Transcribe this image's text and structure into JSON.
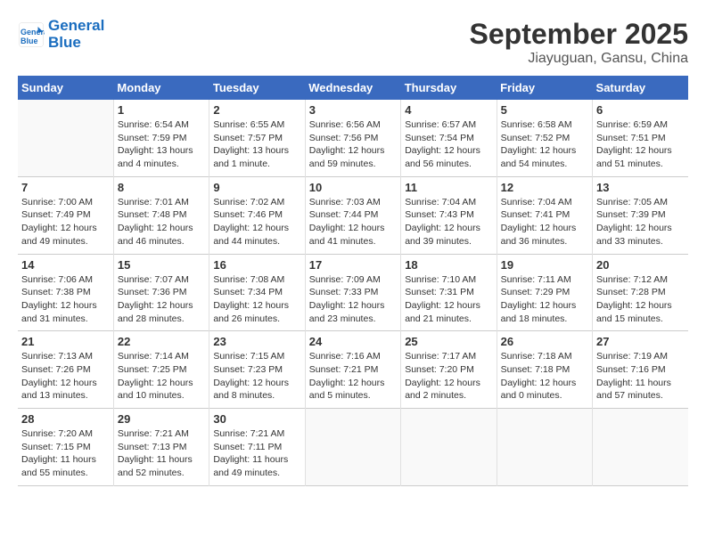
{
  "header": {
    "logo_line1": "General",
    "logo_line2": "Blue",
    "title": "September 2025",
    "subtitle": "Jiayuguan, Gansu, China"
  },
  "days_of_week": [
    "Sunday",
    "Monday",
    "Tuesday",
    "Wednesday",
    "Thursday",
    "Friday",
    "Saturday"
  ],
  "weeks": [
    [
      {
        "day": "",
        "info": ""
      },
      {
        "day": "1",
        "info": "Sunrise: 6:54 AM\nSunset: 7:59 PM\nDaylight: 13 hours\nand 4 minutes."
      },
      {
        "day": "2",
        "info": "Sunrise: 6:55 AM\nSunset: 7:57 PM\nDaylight: 13 hours\nand 1 minute."
      },
      {
        "day": "3",
        "info": "Sunrise: 6:56 AM\nSunset: 7:56 PM\nDaylight: 12 hours\nand 59 minutes."
      },
      {
        "day": "4",
        "info": "Sunrise: 6:57 AM\nSunset: 7:54 PM\nDaylight: 12 hours\nand 56 minutes."
      },
      {
        "day": "5",
        "info": "Sunrise: 6:58 AM\nSunset: 7:52 PM\nDaylight: 12 hours\nand 54 minutes."
      },
      {
        "day": "6",
        "info": "Sunrise: 6:59 AM\nSunset: 7:51 PM\nDaylight: 12 hours\nand 51 minutes."
      }
    ],
    [
      {
        "day": "7",
        "info": "Sunrise: 7:00 AM\nSunset: 7:49 PM\nDaylight: 12 hours\nand 49 minutes."
      },
      {
        "day": "8",
        "info": "Sunrise: 7:01 AM\nSunset: 7:48 PM\nDaylight: 12 hours\nand 46 minutes."
      },
      {
        "day": "9",
        "info": "Sunrise: 7:02 AM\nSunset: 7:46 PM\nDaylight: 12 hours\nand 44 minutes."
      },
      {
        "day": "10",
        "info": "Sunrise: 7:03 AM\nSunset: 7:44 PM\nDaylight: 12 hours\nand 41 minutes."
      },
      {
        "day": "11",
        "info": "Sunrise: 7:04 AM\nSunset: 7:43 PM\nDaylight: 12 hours\nand 39 minutes."
      },
      {
        "day": "12",
        "info": "Sunrise: 7:04 AM\nSunset: 7:41 PM\nDaylight: 12 hours\nand 36 minutes."
      },
      {
        "day": "13",
        "info": "Sunrise: 7:05 AM\nSunset: 7:39 PM\nDaylight: 12 hours\nand 33 minutes."
      }
    ],
    [
      {
        "day": "14",
        "info": "Sunrise: 7:06 AM\nSunset: 7:38 PM\nDaylight: 12 hours\nand 31 minutes."
      },
      {
        "day": "15",
        "info": "Sunrise: 7:07 AM\nSunset: 7:36 PM\nDaylight: 12 hours\nand 28 minutes."
      },
      {
        "day": "16",
        "info": "Sunrise: 7:08 AM\nSunset: 7:34 PM\nDaylight: 12 hours\nand 26 minutes."
      },
      {
        "day": "17",
        "info": "Sunrise: 7:09 AM\nSunset: 7:33 PM\nDaylight: 12 hours\nand 23 minutes."
      },
      {
        "day": "18",
        "info": "Sunrise: 7:10 AM\nSunset: 7:31 PM\nDaylight: 12 hours\nand 21 minutes."
      },
      {
        "day": "19",
        "info": "Sunrise: 7:11 AM\nSunset: 7:29 PM\nDaylight: 12 hours\nand 18 minutes."
      },
      {
        "day": "20",
        "info": "Sunrise: 7:12 AM\nSunset: 7:28 PM\nDaylight: 12 hours\nand 15 minutes."
      }
    ],
    [
      {
        "day": "21",
        "info": "Sunrise: 7:13 AM\nSunset: 7:26 PM\nDaylight: 12 hours\nand 13 minutes."
      },
      {
        "day": "22",
        "info": "Sunrise: 7:14 AM\nSunset: 7:25 PM\nDaylight: 12 hours\nand 10 minutes."
      },
      {
        "day": "23",
        "info": "Sunrise: 7:15 AM\nSunset: 7:23 PM\nDaylight: 12 hours\nand 8 minutes."
      },
      {
        "day": "24",
        "info": "Sunrise: 7:16 AM\nSunset: 7:21 PM\nDaylight: 12 hours\nand 5 minutes."
      },
      {
        "day": "25",
        "info": "Sunrise: 7:17 AM\nSunset: 7:20 PM\nDaylight: 12 hours\nand 2 minutes."
      },
      {
        "day": "26",
        "info": "Sunrise: 7:18 AM\nSunset: 7:18 PM\nDaylight: 12 hours\nand 0 minutes."
      },
      {
        "day": "27",
        "info": "Sunrise: 7:19 AM\nSunset: 7:16 PM\nDaylight: 11 hours\nand 57 minutes."
      }
    ],
    [
      {
        "day": "28",
        "info": "Sunrise: 7:20 AM\nSunset: 7:15 PM\nDaylight: 11 hours\nand 55 minutes."
      },
      {
        "day": "29",
        "info": "Sunrise: 7:21 AM\nSunset: 7:13 PM\nDaylight: 11 hours\nand 52 minutes."
      },
      {
        "day": "30",
        "info": "Sunrise: 7:21 AM\nSunset: 7:11 PM\nDaylight: 11 hours\nand 49 minutes."
      },
      {
        "day": "",
        "info": ""
      },
      {
        "day": "",
        "info": ""
      },
      {
        "day": "",
        "info": ""
      },
      {
        "day": "",
        "info": ""
      }
    ]
  ]
}
